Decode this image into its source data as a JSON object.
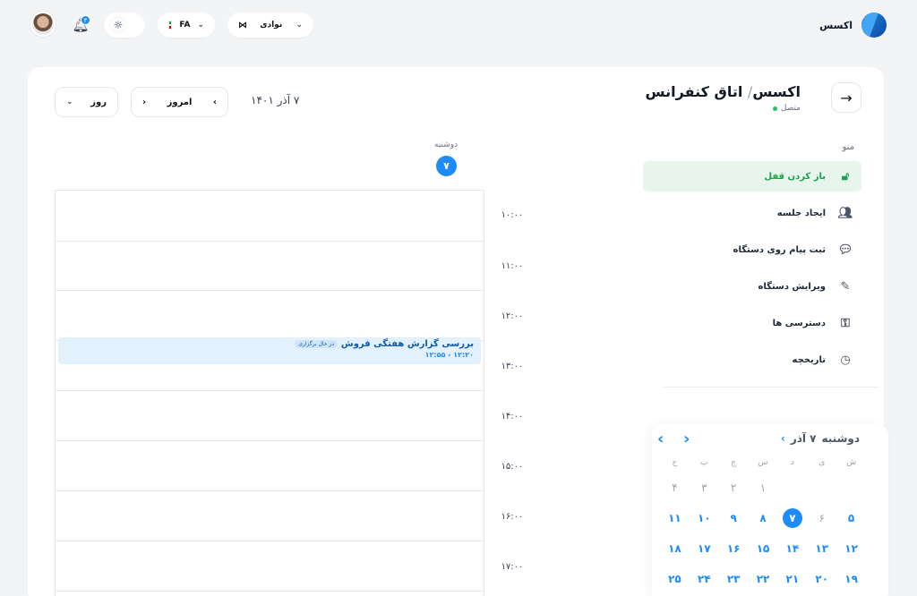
{
  "header": {
    "brand": "اکسس",
    "user_name": "نوادی",
    "language": "FA"
  },
  "notifications": {
    "count": "۳"
  },
  "page": {
    "title_parent": "اکسس",
    "title_separator": "/",
    "title": "اتاق کنفرانس",
    "status": "متصل"
  },
  "toolbar": {
    "date": "۷ آذر ۱۴۰۱",
    "today_label": "امروز",
    "view_label": "روز"
  },
  "menu": {
    "title": "منو",
    "items": [
      {
        "label": "باز کردن قفل",
        "icon": "lock-icon"
      },
      {
        "label": "ایجاد جلسه",
        "icon": "users-icon"
      },
      {
        "label": "ثبت پیام روی دستگاه",
        "icon": "message-icon"
      },
      {
        "label": "ویرایش دستگاه",
        "icon": "edit-icon"
      },
      {
        "label": "دسترسی ها",
        "icon": "key-icon"
      },
      {
        "label": "تاریخچه",
        "icon": "clock-icon"
      }
    ]
  },
  "day_view": {
    "weekday": "دوشنبه",
    "day": "۷",
    "times": [
      "۱۰:۰۰",
      "۱۱:۰۰",
      "۱۲:۰۰",
      "۱۳:۰۰",
      "۱۴:۰۰",
      "۱۵:۰۰",
      "۱۶:۰۰",
      "۱۷:۰۰"
    ],
    "event": {
      "title": "بررسی گزارش هفتگی فروش",
      "badge": "در حال برگزاری",
      "time": "۱۲:۲۰ - ۱۲:۵۵"
    }
  },
  "calendar": {
    "header_day": "دوشنبه",
    "header_date": "۷ آذر",
    "weekdays": [
      "ش",
      "ی",
      "د",
      "س",
      "چ",
      "پ",
      "ج"
    ],
    "rows": [
      [
        {
          "d": ""
        },
        {
          "d": ""
        },
        {
          "d": ""
        },
        {
          "d": "۱",
          "muted": true
        },
        {
          "d": "۲",
          "muted": true
        },
        {
          "d": "۳",
          "muted": true
        },
        {
          "d": "۴",
          "muted": true
        }
      ],
      [
        {
          "d": "۵"
        },
        {
          "d": "۶",
          "muted": true
        },
        {
          "d": "۷",
          "today": true
        },
        {
          "d": "۸"
        },
        {
          "d": "۹"
        },
        {
          "d": "۱۰"
        },
        {
          "d": "۱۱"
        }
      ],
      [
        {
          "d": "۱۲"
        },
        {
          "d": "۱۳"
        },
        {
          "d": "۱۴"
        },
        {
          "d": "۱۵"
        },
        {
          "d": "۱۶"
        },
        {
          "d": "۱۷"
        },
        {
          "d": "۱۸"
        }
      ],
      [
        {
          "d": "۱۹"
        },
        {
          "d": "۲۰"
        },
        {
          "d": "۲۱"
        },
        {
          "d": "۲۲"
        },
        {
          "d": "۲۳"
        },
        {
          "d": "۲۴"
        },
        {
          "d": "۲۵"
        }
      ]
    ]
  },
  "colors": {
    "accent": "#1d8cf8",
    "success": "#16a34a",
    "active_bg": "#e8f5ec",
    "event_bg": "#e3f1fd"
  }
}
